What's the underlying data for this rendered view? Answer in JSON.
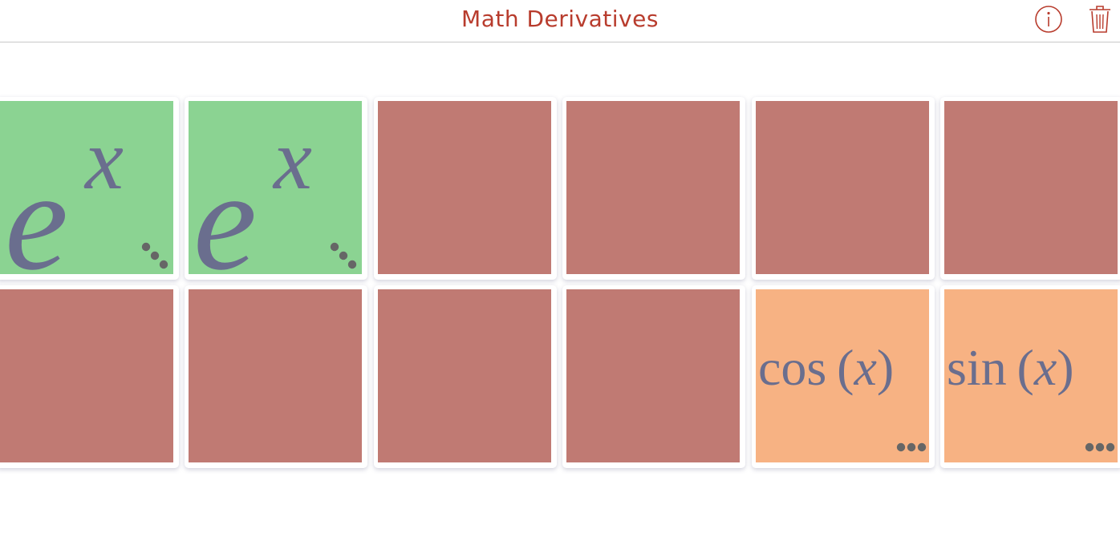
{
  "header": {
    "title": "Math Derivatives",
    "info_icon": "info-circle-icon",
    "trash_icon": "trash-icon"
  },
  "colors": {
    "title": "#b83c2d",
    "card_back": "#c07a73",
    "card_matched": "#8bd392",
    "card_selected": "#f7b283",
    "math_text": "#6a6e8e"
  },
  "board": {
    "rows": [
      [
        {
          "state": "matched",
          "base": "e",
          "sup": "x",
          "more_icon": "ellipsis-diagonal-icon"
        },
        {
          "state": "matched",
          "base": "e",
          "sup": "x",
          "more_icon": "ellipsis-diagonal-icon"
        },
        {
          "state": "face-down"
        },
        {
          "state": "face-down"
        },
        {
          "state": "face-down"
        },
        {
          "state": "face-down"
        }
      ],
      [
        {
          "state": "face-down"
        },
        {
          "state": "face-down"
        },
        {
          "state": "face-down"
        },
        {
          "state": "face-down"
        },
        {
          "state": "selected",
          "fn": "cos",
          "open": "(",
          "var": "x",
          "close": ")",
          "more_icon": "ellipsis-horizontal-icon"
        },
        {
          "state": "selected",
          "fn": "sin",
          "open": "(",
          "var": "x",
          "close": ")",
          "more_icon": "ellipsis-horizontal-icon"
        }
      ]
    ]
  }
}
